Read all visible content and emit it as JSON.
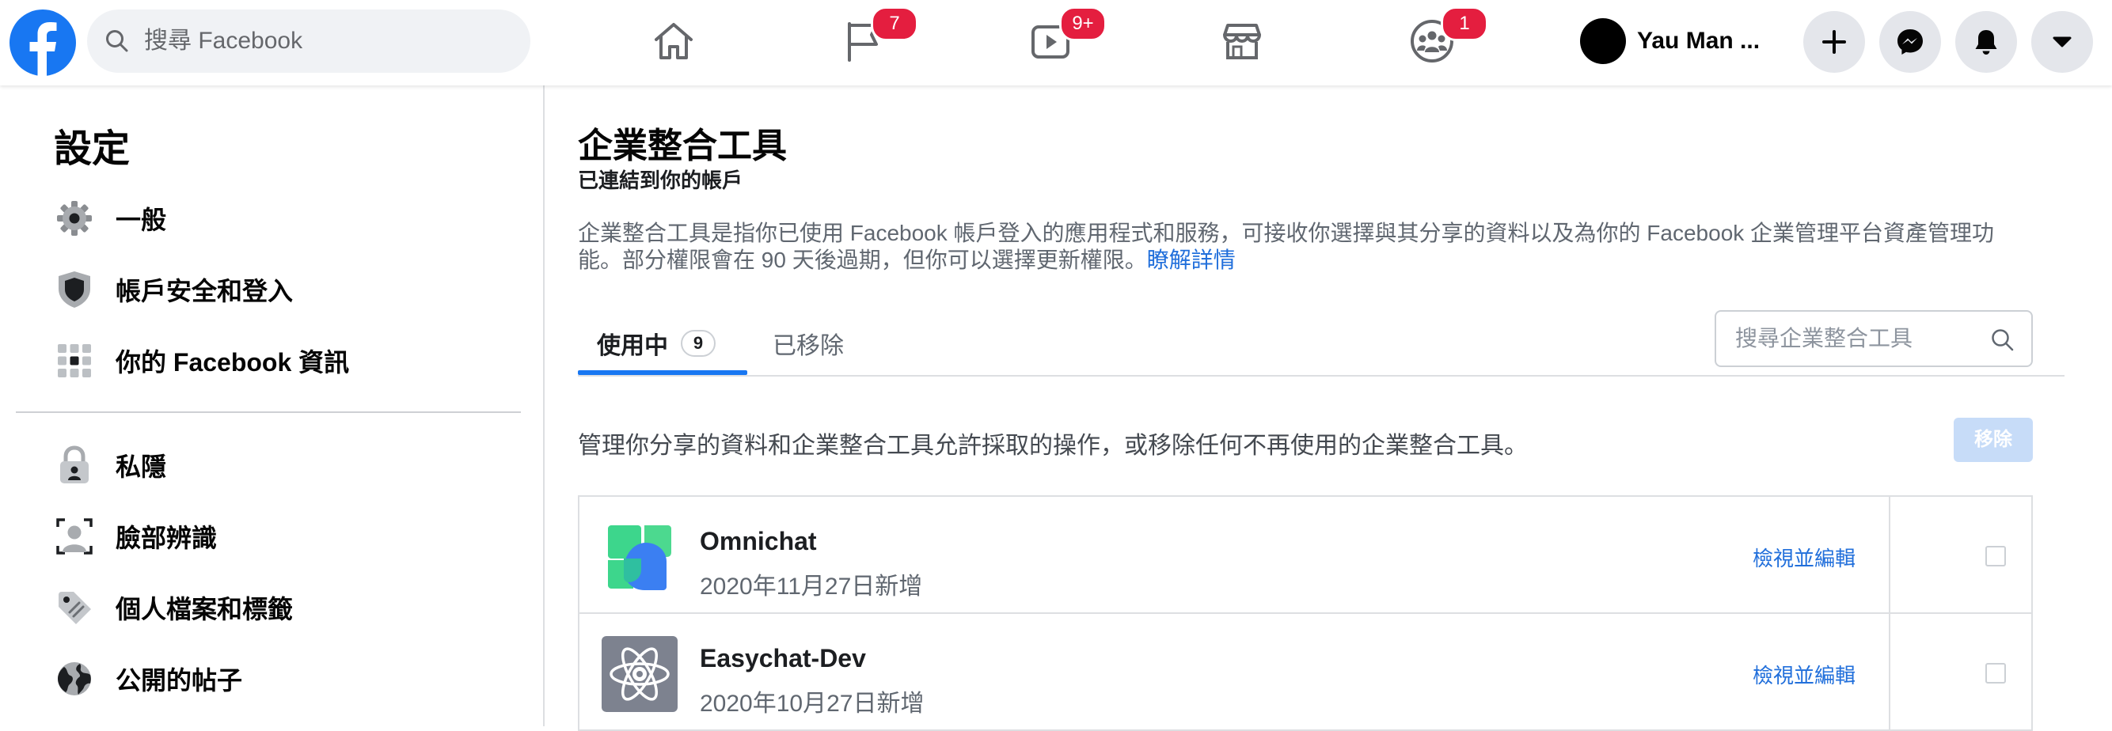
{
  "topbar": {
    "search_placeholder": "搜尋 Facebook",
    "badges": {
      "pages": "7",
      "watch": "9+",
      "groups": "1"
    },
    "profile_name": "Yau Man ..."
  },
  "sidebar": {
    "title": "設定",
    "items": [
      {
        "label": "一般",
        "icon": "gear-icon"
      },
      {
        "label": "帳戶安全和登入",
        "icon": "shield-icon"
      },
      {
        "label": "你的 Facebook 資訊",
        "icon": "facebook-info-icon"
      },
      {
        "label": "私隱",
        "icon": "lock-icon"
      },
      {
        "label": "臉部辨識",
        "icon": "face-recognition-icon"
      },
      {
        "label": "個人檔案和標籤",
        "icon": "tag-icon"
      },
      {
        "label": "公開的帖子",
        "icon": "globe-icon"
      }
    ]
  },
  "main": {
    "title": "企業整合工具",
    "subtitle": "已連結到你的帳戶",
    "description": "企業整合工具是指你已使用 Facebook 帳戶登入的應用程式和服務，可接收你選擇與其分享的資料以及為你的 Facebook 企業管理平台資產管理功能。部分權限會在 90 天後過期，但你可以選擇更新權限。",
    "learn_more": "瞭解詳情",
    "tabs": {
      "active_label": "使用中",
      "active_count": "9",
      "removed_label": "已移除"
    },
    "search_placeholder": "搜尋企業整合工具",
    "manage_text": "管理你分享的資料和企業整合工具允許採取的操作，或移除任何不再使用的企業整合工具。",
    "remove_button": "移除",
    "integrations": [
      {
        "name": "Omnichat",
        "added": "2020年11月27日新增",
        "action": "檢視並編輯",
        "checked": false
      },
      {
        "name": "Easychat-Dev",
        "added": "2020年10月27日新增",
        "action": "檢視並編輯",
        "checked": false
      }
    ]
  },
  "colors": {
    "brand": "#1877f2",
    "badge": "#e41e3f",
    "link": "#216fdb"
  }
}
